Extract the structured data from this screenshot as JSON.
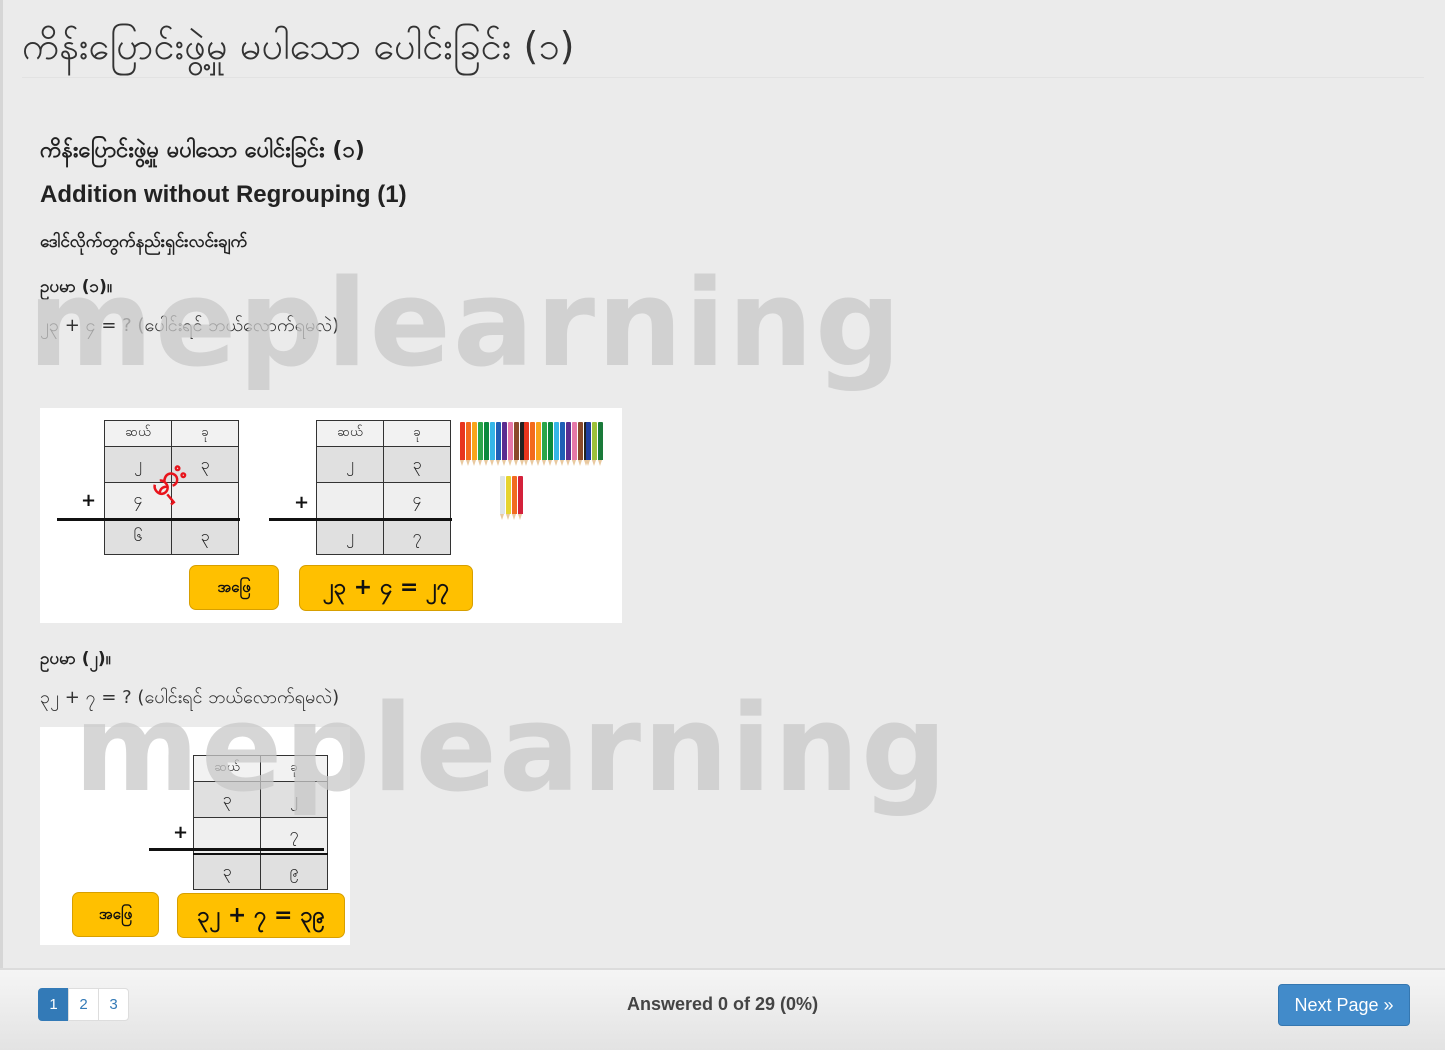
{
  "page": {
    "title": "ကိန်းပြောင်းဖွဲ့မှု မပါသော ပေါင်းခြင်း (၁)"
  },
  "lesson": {
    "title_mm": "ကိန်းပြောင်းဖွဲ့မှု မပါသော ပေါင်းခြင်း (၁)",
    "title_en": "Addition without Regrouping (1)",
    "subheading": "ဒေါင်လိုက်တွက်နည်းရှင်းလင်းချက်",
    "watermark": "meplearning",
    "examples": [
      {
        "label": "ဥပမာ (၁)။",
        "problem": "၂၃ + ၄ = ? (ပေါင်းရင် ဘယ်လောက်ရမလဲ)",
        "tables": [
          {
            "headers": [
              "ဆယ်",
              "ခု"
            ],
            "row1": [
              "၂",
              "၃"
            ],
            "row2": [
              "၄",
              ""
            ],
            "result": [
              "၆",
              "၃"
            ],
            "plus": "+",
            "annotation": "မှား"
          },
          {
            "headers": [
              "ဆယ်",
              "ခု"
            ],
            "row1": [
              "၂",
              "၃"
            ],
            "row2": [
              "",
              "၄"
            ],
            "result": [
              "၂",
              "၇"
            ],
            "plus": "+"
          }
        ],
        "answer_label": "အဖြေ",
        "answer": "၂၃ + ၄ = ၂၇",
        "illustration": "colored-pencils"
      },
      {
        "label": "ဥပမာ (၂)။",
        "problem": "၃၂ + ၇ = ? (ပေါင်းရင် ဘယ်လောက်ရမလဲ)",
        "tables": [
          {
            "headers": [
              "ဆယ်",
              "ခု"
            ],
            "row1": [
              "၃",
              "၂"
            ],
            "row2": [
              "",
              "၇"
            ],
            "result": [
              "၃",
              "၉"
            ],
            "plus": "+"
          }
        ],
        "answer_label": "အဖြေ",
        "answer": "၃၂ + ၇ = ၃၉"
      }
    ]
  },
  "footer": {
    "pages": [
      "1",
      "2",
      "3"
    ],
    "current_page": "1",
    "progress_text": "Answered 0 of 29 (0%)",
    "answered": 0,
    "total": 29,
    "percent": 0,
    "next_label": "Next Page »"
  },
  "colors": {
    "accent": "#337ab7",
    "next_button": "#428bca",
    "answer_box": "#ffc000",
    "error_mark": "#e8141c",
    "background": "#ebebeb"
  }
}
